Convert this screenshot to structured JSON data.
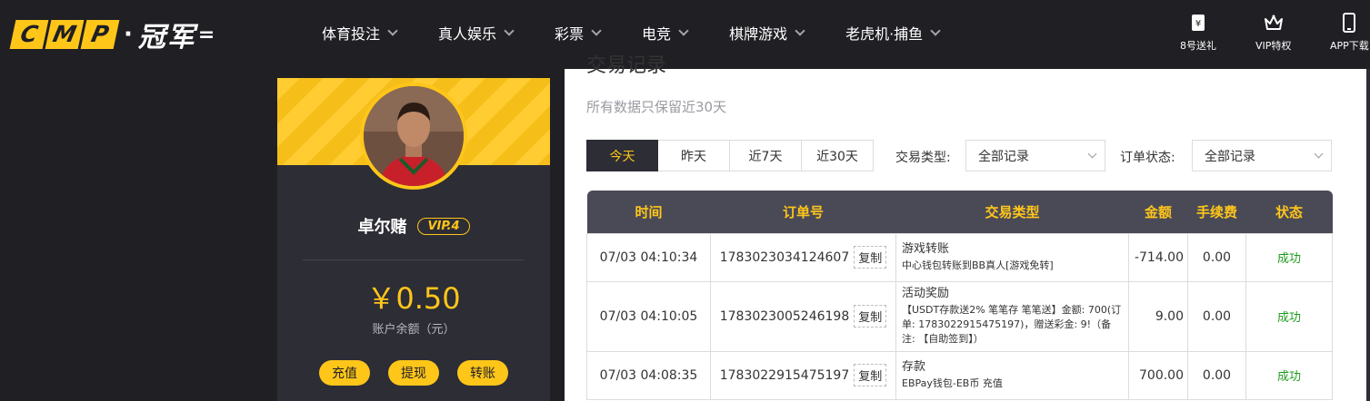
{
  "logo": {
    "letters": [
      "C",
      "M",
      "P"
    ],
    "dot": "·",
    "cn": "冠军",
    "tail": "="
  },
  "nav": [
    {
      "label": "体育投注"
    },
    {
      "label": "真人娱乐"
    },
    {
      "label": "彩票"
    },
    {
      "label": "电竞"
    },
    {
      "label": "棋牌游戏"
    },
    {
      "label": "老虎机·捕鱼"
    }
  ],
  "quick_links": [
    {
      "label": "8号送礼",
      "icon": "gift-ticket-icon"
    },
    {
      "label": "VIP特权",
      "icon": "crown-icon"
    },
    {
      "label": "APP下载",
      "icon": "phone-icon"
    }
  ],
  "profile": {
    "username": "卓尔赌",
    "vip": "VIP.4",
    "balance": "￥0.50",
    "balance_label": "账户余额（元）",
    "actions": [
      "充值",
      "提现",
      "转账"
    ]
  },
  "content": {
    "title": "交易记录",
    "note": "所有数据只保留近30天",
    "date_tabs": [
      {
        "label": "今天",
        "active": true
      },
      {
        "label": "昨天",
        "active": false
      },
      {
        "label": "近7天",
        "active": false
      },
      {
        "label": "近30天",
        "active": false
      }
    ],
    "filters": {
      "type_label": "交易类型:",
      "type_value": "全部记录",
      "status_label": "订单状态:",
      "status_value": "全部记录"
    },
    "table": {
      "headers": [
        "时间",
        "订单号",
        "交易类型",
        "金额",
        "手续费",
        "状态"
      ],
      "copy_label": "复制",
      "rows": [
        {
          "time": "07/03 04:10:34",
          "order": "1783023034124607",
          "type_main": "游戏转账",
          "type_sub": "中心钱包转账到BB真人[游戏免转]",
          "amount": "-714.00",
          "fee": "0.00",
          "status": "成功"
        },
        {
          "time": "07/03 04:10:05",
          "order": "1783023005246198",
          "type_main": "活动奖励",
          "type_sub": "【USDT存款送2% 笔笔存 笔笔送】金额: 700(订单: 1783022915475197)，赠送彩金: 9!（备注: 【自助签到】）",
          "amount": "9.00",
          "fee": "0.00",
          "status": "成功"
        },
        {
          "time": "07/03 04:08:35",
          "order": "1783022915475197",
          "type_main": "存款",
          "type_sub": "EBPay钱包-EB币 充值",
          "amount": "700.00",
          "fee": "0.00",
          "status": "成功"
        }
      ]
    }
  },
  "colors": {
    "accent": "#ffc61a",
    "dark": "#1f1f24",
    "panel": "#2d2d35",
    "header": "#4a4a57",
    "success": "#1e9a1e"
  }
}
